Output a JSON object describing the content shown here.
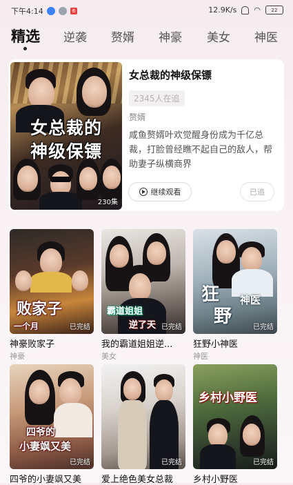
{
  "status_bar": {
    "time": "下午4:14",
    "badge": "6",
    "speed": "12.9K/s",
    "battery": "22"
  },
  "tabs": [
    {
      "label": "精选",
      "active": true
    },
    {
      "label": "逆袭"
    },
    {
      "label": "赘婿"
    },
    {
      "label": "神豪"
    },
    {
      "label": "美女"
    },
    {
      "label": "神医"
    }
  ],
  "featured": {
    "title": "女总裁的神级保镖",
    "follow_count": "2345人在追",
    "genre": "赘婿",
    "description": "咸鱼赘婿叶欢觉醒身份成为千亿总裁，打脸曾经瞧不起自己的敌人，帮助妻子纵横商界",
    "poster_title_line1": "女总裁的",
    "poster_title_line2": "神级保镖",
    "poster_count": "230集",
    "continue_label": "继续观看",
    "followed_label": "已追"
  },
  "dramas": [
    {
      "title": "神豪败家子",
      "genre": "神豪",
      "status": "已完结",
      "poster_text": "败家子",
      "poster_text2": "一个月"
    },
    {
      "title": "我的霸道姐姐逆...",
      "genre": "美女",
      "status": "已完结",
      "poster_text": "霸道姐姐",
      "poster_text2": "逆了天"
    },
    {
      "title": "狂野小神医",
      "genre": "神医",
      "status": "已完结",
      "poster_text": "狂",
      "poster_text2": "野",
      "poster_text3": "神医"
    },
    {
      "title": "四爷的小妻飒又美",
      "genre": "",
      "status": "已完结",
      "poster_text": "四爷的",
      "poster_text2": "小妻飒又美"
    },
    {
      "title": "爱上绝色美女总裁",
      "genre": "",
      "status": "已完结",
      "poster_text": ""
    },
    {
      "title": "乡村小野医",
      "genre": "",
      "status": "已完结",
      "poster_text": "乡村小野医"
    }
  ],
  "colors": {
    "accent_badge": "#e84545",
    "background": "#f6ecef"
  }
}
